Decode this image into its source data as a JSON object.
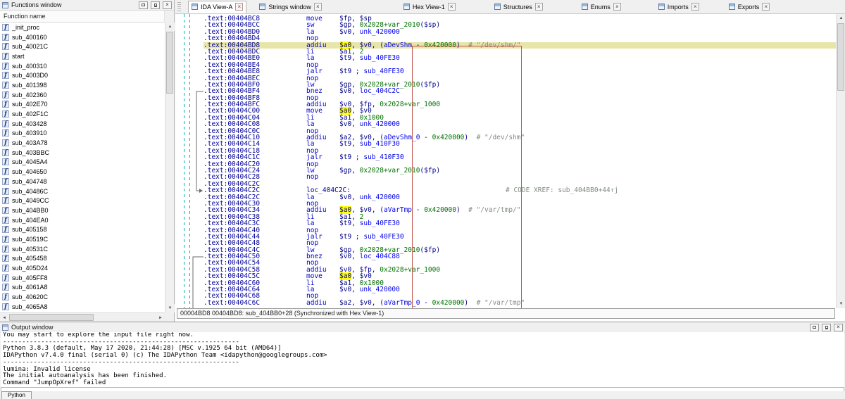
{
  "colors": {
    "current_line_bg": "#e8e5a9",
    "token_highlight_bg": "#ffff00",
    "annotation_box_border": "#c0544c",
    "splitter_dash": "#00b2b2"
  },
  "icons": {
    "close": "×",
    "scroll_up": "▲",
    "scroll_down": "▼",
    "scroll_left": "◄",
    "scroll_right": "►"
  },
  "functions": {
    "title": "Functions window",
    "header": "Function name",
    "items": [
      "_init_proc",
      "sub_400160",
      "sub_40021C",
      "start",
      "sub_400310",
      "sub_4003D0",
      "sub_401398",
      "sub_402360",
      "sub_402E70",
      "sub_402F1C",
      "sub_403428",
      "sub_403910",
      "sub_403A78",
      "sub_403BBC",
      "sub_4045A4",
      "sub_404650",
      "sub_404748",
      "sub_40486C",
      "sub_4049CC",
      "sub_404BB0",
      "sub_404EA0",
      "sub_405158",
      "sub_40519C",
      "sub_40531C",
      "sub_405458",
      "sub_405D24",
      "sub_405FF8",
      "sub_4061A8",
      "sub_40620C",
      "sub_4065A8"
    ]
  },
  "tabs": [
    {
      "label": "IDA View-A",
      "active": true
    },
    {
      "label": "Strings window",
      "active": false
    },
    {
      "label": "Hex View-1",
      "active": false
    },
    {
      "label": "Structures",
      "active": false
    },
    {
      "label": "Enums",
      "active": false
    },
    {
      "label": "Imports",
      "active": false
    },
    {
      "label": "Exports",
      "active": false
    }
  ],
  "disasm": {
    "lines": [
      {
        "addr": ".text:00404BC8",
        "mn": "move",
        "ops": [
          [
            "r",
            "$fp"
          ],
          [
            "p",
            ", "
          ],
          [
            "r",
            "$sp"
          ]
        ]
      },
      {
        "addr": ".text:00404BCC",
        "mn": "sw",
        "ops": [
          [
            "r",
            "$gp"
          ],
          [
            "p",
            ", "
          ],
          [
            "n",
            "0x2028+var_2010"
          ],
          [
            "p",
            "("
          ],
          [
            "r",
            "$sp"
          ],
          [
            "p",
            ")"
          ]
        ]
      },
      {
        "addr": ".text:00404BD0",
        "mn": "la",
        "ops": [
          [
            "r",
            "$v0"
          ],
          [
            "p",
            ", "
          ],
          [
            "f",
            "unk_420000"
          ]
        ]
      },
      {
        "addr": ".text:00404BD4",
        "mn": "nop",
        "ops": []
      },
      {
        "addr": ".text:00404BD8",
        "cur": true,
        "mn": "addiu",
        "ops": [
          [
            "h",
            "$a0"
          ],
          [
            "p",
            ", "
          ],
          [
            "r",
            "$v0"
          ],
          [
            "p",
            ", ("
          ],
          [
            "f",
            "aDevShm"
          ],
          [
            "p",
            " - "
          ],
          [
            "n",
            "0x420000"
          ],
          [
            "p",
            ")"
          ],
          [
            "c",
            "  # \"/dev/shm/\""
          ]
        ]
      },
      {
        "addr": ".text:00404BDC",
        "mn": "li",
        "ops": [
          [
            "r",
            "$a1"
          ],
          [
            "p",
            ", "
          ],
          [
            "n",
            "2"
          ]
        ]
      },
      {
        "addr": ".text:00404BE0",
        "mn": "la",
        "ops": [
          [
            "r",
            "$t9"
          ],
          [
            "p",
            ", "
          ],
          [
            "f",
            "sub_40FE30"
          ]
        ]
      },
      {
        "addr": ".text:00404BE4",
        "mn": "nop",
        "ops": []
      },
      {
        "addr": ".text:00404BE8",
        "mn": "jalr",
        "ops": [
          [
            "r",
            "$t9"
          ],
          [
            "p",
            " ; "
          ],
          [
            "f",
            "sub_40FE30"
          ]
        ]
      },
      {
        "addr": ".text:00404BEC",
        "mn": "nop",
        "ops": []
      },
      {
        "addr": ".text:00404BF0",
        "mn": "lw",
        "ops": [
          [
            "r",
            "$gp"
          ],
          [
            "p",
            ", "
          ],
          [
            "n",
            "0x2028+var_2010"
          ],
          [
            "p",
            "("
          ],
          [
            "r",
            "$fp"
          ],
          [
            "p",
            ")"
          ]
        ]
      },
      {
        "addr": ".text:00404BF4",
        "mn": "bnez",
        "ops": [
          [
            "r",
            "$v0"
          ],
          [
            "p",
            ", "
          ],
          [
            "f",
            "loc_404C2C"
          ]
        ]
      },
      {
        "addr": ".text:00404BF8",
        "mn": "nop",
        "ops": []
      },
      {
        "addr": ".text:00404BFC",
        "mn": "addiu",
        "ops": [
          [
            "r",
            "$v0"
          ],
          [
            "p",
            ", "
          ],
          [
            "r",
            "$fp"
          ],
          [
            "p",
            ", "
          ],
          [
            "n",
            "0x2028+var_1000"
          ]
        ]
      },
      {
        "addr": ".text:00404C00",
        "mn": "move",
        "ops": [
          [
            "h",
            "$a0"
          ],
          [
            "p",
            ", "
          ],
          [
            "r",
            "$v0"
          ]
        ]
      },
      {
        "addr": ".text:00404C04",
        "mn": "li",
        "ops": [
          [
            "r",
            "$a1"
          ],
          [
            "p",
            ", "
          ],
          [
            "n",
            "0x1000"
          ]
        ]
      },
      {
        "addr": ".text:00404C08",
        "mn": "la",
        "ops": [
          [
            "r",
            "$v0"
          ],
          [
            "p",
            ", "
          ],
          [
            "f",
            "unk_420000"
          ]
        ]
      },
      {
        "addr": ".text:00404C0C",
        "mn": "nop",
        "ops": []
      },
      {
        "addr": ".text:00404C10",
        "mn": "addiu",
        "ops": [
          [
            "r",
            "$a2"
          ],
          [
            "p",
            ", "
          ],
          [
            "r",
            "$v0"
          ],
          [
            "p",
            ", ("
          ],
          [
            "f",
            "aDevShm_0"
          ],
          [
            "p",
            " - "
          ],
          [
            "n",
            "0x420000"
          ],
          [
            "p",
            ")"
          ],
          [
            "c",
            "  # \"/dev/shm\""
          ]
        ]
      },
      {
        "addr": ".text:00404C14",
        "mn": "la",
        "ops": [
          [
            "r",
            "$t9"
          ],
          [
            "p",
            ", "
          ],
          [
            "f",
            "sub_410F30"
          ]
        ]
      },
      {
        "addr": ".text:00404C18",
        "mn": "nop",
        "ops": []
      },
      {
        "addr": ".text:00404C1C",
        "mn": "jalr",
        "ops": [
          [
            "r",
            "$t9"
          ],
          [
            "p",
            " ; "
          ],
          [
            "f",
            "sub_410F30"
          ]
        ]
      },
      {
        "addr": ".text:00404C20",
        "mn": "nop",
        "ops": []
      },
      {
        "addr": ".text:00404C24",
        "mn": "lw",
        "ops": [
          [
            "r",
            "$gp"
          ],
          [
            "p",
            ", "
          ],
          [
            "n",
            "0x2028+var_2010"
          ],
          [
            "p",
            "("
          ],
          [
            "r",
            "$fp"
          ],
          [
            "p",
            ")"
          ]
        ]
      },
      {
        "addr": ".text:00404C28",
        "mn": "nop",
        "ops": []
      },
      {
        "addr": ".text:00404C2C",
        "mn": "",
        "ops": []
      },
      {
        "addr": ".text:00404C2C",
        "label": "loc_404C2C:",
        "xref": "# CODE XREF: sub_404BB0+44↑j"
      },
      {
        "addr": ".text:00404C2C",
        "mn": "la",
        "ops": [
          [
            "r",
            "$v0"
          ],
          [
            "p",
            ", "
          ],
          [
            "f",
            "unk_420000"
          ]
        ]
      },
      {
        "addr": ".text:00404C30",
        "mn": "nop",
        "ops": []
      },
      {
        "addr": ".text:00404C34",
        "mn": "addiu",
        "ops": [
          [
            "h",
            "$a0"
          ],
          [
            "p",
            ", "
          ],
          [
            "r",
            "$v0"
          ],
          [
            "p",
            ", ("
          ],
          [
            "f",
            "aVarTmp"
          ],
          [
            "p",
            " - "
          ],
          [
            "n",
            "0x420000"
          ],
          [
            "p",
            ")"
          ],
          [
            "c",
            "  # \"/var/tmp/\""
          ]
        ]
      },
      {
        "addr": ".text:00404C38",
        "mn": "li",
        "ops": [
          [
            "r",
            "$a1"
          ],
          [
            "p",
            ", "
          ],
          [
            "n",
            "2"
          ]
        ]
      },
      {
        "addr": ".text:00404C3C",
        "mn": "la",
        "ops": [
          [
            "r",
            "$t9"
          ],
          [
            "p",
            ", "
          ],
          [
            "f",
            "sub_40FE30"
          ]
        ]
      },
      {
        "addr": ".text:00404C40",
        "mn": "nop",
        "ops": []
      },
      {
        "addr": ".text:00404C44",
        "mn": "jalr",
        "ops": [
          [
            "r",
            "$t9"
          ],
          [
            "p",
            " ; "
          ],
          [
            "f",
            "sub_40FE30"
          ]
        ]
      },
      {
        "addr": ".text:00404C48",
        "mn": "nop",
        "ops": []
      },
      {
        "addr": ".text:00404C4C",
        "mn": "lw",
        "ops": [
          [
            "r",
            "$gp"
          ],
          [
            "p",
            ", "
          ],
          [
            "n",
            "0x2028+var_2010"
          ],
          [
            "p",
            "("
          ],
          [
            "r",
            "$fp"
          ],
          [
            "p",
            ")"
          ]
        ]
      },
      {
        "addr": ".text:00404C50",
        "mn": "bnez",
        "ops": [
          [
            "r",
            "$v0"
          ],
          [
            "p",
            ", "
          ],
          [
            "f",
            "loc_404C88"
          ]
        ]
      },
      {
        "addr": ".text:00404C54",
        "mn": "nop",
        "ops": []
      },
      {
        "addr": ".text:00404C58",
        "mn": "addiu",
        "ops": [
          [
            "r",
            "$v0"
          ],
          [
            "p",
            ", "
          ],
          [
            "r",
            "$fp"
          ],
          [
            "p",
            ", "
          ],
          [
            "n",
            "0x2028+var_1000"
          ]
        ]
      },
      {
        "addr": ".text:00404C5C",
        "mn": "move",
        "ops": [
          [
            "h",
            "$a0"
          ],
          [
            "p",
            ", "
          ],
          [
            "r",
            "$v0"
          ]
        ]
      },
      {
        "addr": ".text:00404C60",
        "mn": "li",
        "ops": [
          [
            "r",
            "$a1"
          ],
          [
            "p",
            ", "
          ],
          [
            "n",
            "0x1000"
          ]
        ]
      },
      {
        "addr": ".text:00404C64",
        "mn": "la",
        "ops": [
          [
            "r",
            "$v0"
          ],
          [
            "p",
            ", "
          ],
          [
            "f",
            "unk_420000"
          ]
        ]
      },
      {
        "addr": ".text:00404C68",
        "mn": "nop",
        "ops": []
      },
      {
        "addr": ".text:00404C6C",
        "mn": "addiu",
        "ops": [
          [
            "r",
            "$a2"
          ],
          [
            "p",
            ", "
          ],
          [
            "r",
            "$v0"
          ],
          [
            "p",
            ", ("
          ],
          [
            "f",
            "aVarTmp_0"
          ],
          [
            "p",
            " - "
          ],
          [
            "n",
            "0x420000"
          ],
          [
            "p",
            ")"
          ],
          [
            "c",
            "  # \"/var/tmp\""
          ]
        ]
      }
    ]
  },
  "status_bar": {
    "text": "00004BD8 00404BD8: sub_404BB0+28 (Synchronized with Hex View-1)"
  },
  "output": {
    "title": "Output window",
    "lines": [
      "You may start to explore the input file right now.",
      "--------------------------------------------------------------",
      "Python 3.8.3 (default, May 17 2020, 21:44:28) [MSC v.1925 64 bit (AMD64)]",
      "IDAPython v7.4.0 final (serial 0) (c) The IDAPython Team <idapython@googlegroups.com>",
      "--------------------------------------------------------------",
      "lumina: Invalid license",
      "The initial autoanalysis has been finished.",
      "Command \"JumpOpXref\" failed"
    ],
    "cli_value": "",
    "tab_label": "Python"
  }
}
